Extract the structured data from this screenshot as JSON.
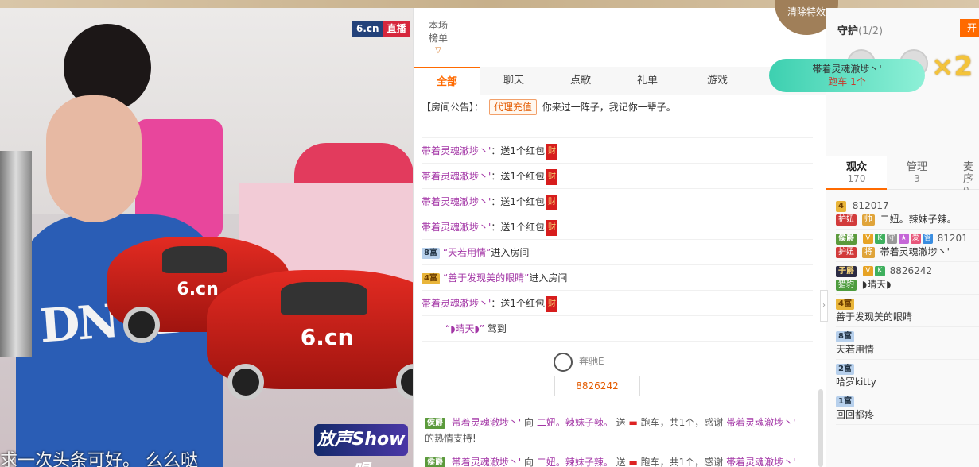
{
  "video": {
    "brand_site": "6.cn",
    "brand_live": "直播",
    "caption": "求一次头条可好。  么么哒",
    "show_logo": "放声Show唱",
    "car_logo": "6.cn"
  },
  "chat": {
    "rank_label_1": "本场",
    "rank_label_2": "榜单",
    "clear_effects": "清除特效",
    "tabs": [
      "全部",
      "聊天",
      "点歌",
      "礼单",
      "游戏"
    ],
    "notice_label": "【房间公告】：",
    "agent_button": "代理充值",
    "notice_text": "你来过一阵子，我记你一辈子。",
    "messages": [
      {
        "nick": "帯着灵魂澈埗丶'",
        "text": "：送1个红包",
        "bag": "财"
      },
      {
        "nick": "帯着灵魂澈埗丶'",
        "text": "：送1个红包",
        "bag": "财"
      },
      {
        "nick": "帯着灵魂澈埗丶'",
        "text": "：送1个红包",
        "bag": "财"
      },
      {
        "nick": "帯着灵魂澈埗丶'",
        "text": "：送1个红包",
        "bag": "财"
      }
    ],
    "enter_1": {
      "level": "8富",
      "nick": "“天若用情”",
      "text": "进入房间"
    },
    "enter_2": {
      "level": "4富",
      "nick": "“善于发现美的眼睛”",
      "text": "进入房间"
    },
    "redbag_msg": {
      "nick": "帯着灵魂澈埗丶'",
      "text": "：送1个红包",
      "bag": "财"
    },
    "drive_msg": {
      "nick": "“◗晴天◗”",
      "text": "驾到"
    },
    "benz_name": "奔驰E",
    "benz_number": "8826242",
    "gift_1": {
      "level": "侯爵",
      "from": "帯着灵魂澈埗丶'",
      "verb": "向",
      "to": "二妞。辣妹子辣。",
      "send": "送",
      "item": "跑车，共1个，感谢",
      "thanks_nick": "帯着灵魂澈埗丶'",
      "tail": "的热情支持!"
    },
    "gift_2": {
      "level": "侯爵",
      "from": "帯着灵魂澈埗丶'",
      "verb": "向",
      "to": "二妞。辣妹子辣。",
      "send": "送",
      "item": "跑车，共1个，感谢",
      "thanks_nick": "帯着灵魂澈埗丶'"
    }
  },
  "right": {
    "guard_title": "守护",
    "guard_count": "(1/2)",
    "open_button": "开",
    "badge_nick": "帯着灵魂澈埗丶'",
    "badge_item": "跑车 1个",
    "multiplier": "×2",
    "tabs": [
      {
        "label": "观众",
        "count": "170"
      },
      {
        "label": "管理",
        "count": "3"
      },
      {
        "label": "麦序",
        "count": "0"
      }
    ],
    "users": [
      {
        "level": "4",
        "id": "812017",
        "role": "护妞",
        "role2": "帅",
        "name": "二妞。辣妹子辣。"
      },
      {
        "level": "侯爵",
        "id": "81201",
        "role": "护妞",
        "role2": "将",
        "name": "帯着灵魂澈埗丶'"
      },
      {
        "level": "子爵",
        "id": "8826242",
        "role": "猎豹",
        "role2": "",
        "name": "◗晴天◗"
      },
      {
        "level": "4富",
        "id": "",
        "role": "",
        "role2": "",
        "name": "善于发现美的眼睛"
      },
      {
        "level": "8富",
        "id": "",
        "role": "",
        "role2": "",
        "name": "天若用情"
      },
      {
        "level": "2富",
        "id": "",
        "role": "",
        "role2": "",
        "name": "哈罗kitty"
      },
      {
        "level": "1富",
        "id": "",
        "role": "",
        "role2": "",
        "name": "回回都疼"
      }
    ]
  },
  "colors": {
    "accent": "#ff6a00",
    "nick": "#a336a6",
    "redbag": "#d71d1d"
  }
}
